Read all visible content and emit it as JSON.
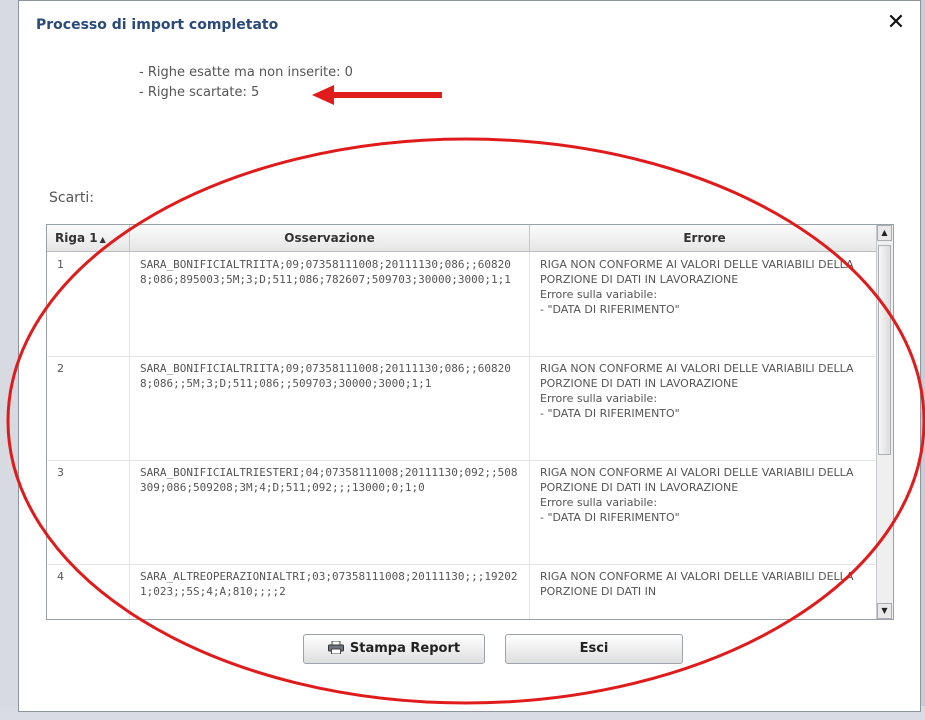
{
  "dialog": {
    "title": "Processo di import completato",
    "close_icon": "close-icon"
  },
  "summary": {
    "line1": "- Righe esatte ma non inserite: 0",
    "line2": "- Righe scartate: 5"
  },
  "discards": {
    "label": "Scarti:",
    "columns": [
      "Riga 1",
      "Osservazione",
      "Errore"
    ],
    "sort_indicator": "▲",
    "rows": [
      {
        "riga": "1",
        "osservazione": "SARA_BONIFICIALTRIITA;09;07358111008;20111130;086;;608208;086;895003;5M;3;D;511;086;782607;509703;30000;3000;1;1",
        "errore": "RIGA NON CONFORME AI VALORI DELLE VARIABILI DELLA PORZIONE DI DATI IN LAVORAZIONE\nErrore sulla variabile:\n - \"DATA DI RIFERIMENTO\""
      },
      {
        "riga": "2",
        "osservazione": "SARA_BONIFICIALTRIITA;09;07358111008;20111130;086;;608208;086;;5M;3;D;511;086;;509703;30000;3000;1;1",
        "errore": "RIGA NON CONFORME AI VALORI DELLE VARIABILI DELLA PORZIONE DI DATI IN LAVORAZIONE\nErrore sulla variabile:\n - \"DATA DI RIFERIMENTO\""
      },
      {
        "riga": "3",
        "osservazione": "SARA_BONIFICIALTRIESTERI;04;07358111008;20111130;092;;508309;086;509208;3M;4;D;511;092;;;13000;0;1;0",
        "errore": "RIGA NON CONFORME AI VALORI DELLE VARIABILI DELLA PORZIONE DI DATI IN LAVORAZIONE\nErrore sulla variabile:\n - \"DATA DI RIFERIMENTO\""
      },
      {
        "riga": "4",
        "osservazione": "SARA_ALTREOPERAZIONIALTRI;03;07358111008;20111130;;;192021;023;;5S;4;A;810;;;;2",
        "errore": "RIGA NON CONFORME AI VALORI DELLE VARIABILI DELLA PORZIONE DI DATI IN"
      }
    ]
  },
  "buttons": {
    "print_label": "Stampa Report",
    "exit_label": "Esci"
  },
  "annotation": {
    "arrow_color": "#e01b1b",
    "ellipse_color": "#e01b1b"
  }
}
